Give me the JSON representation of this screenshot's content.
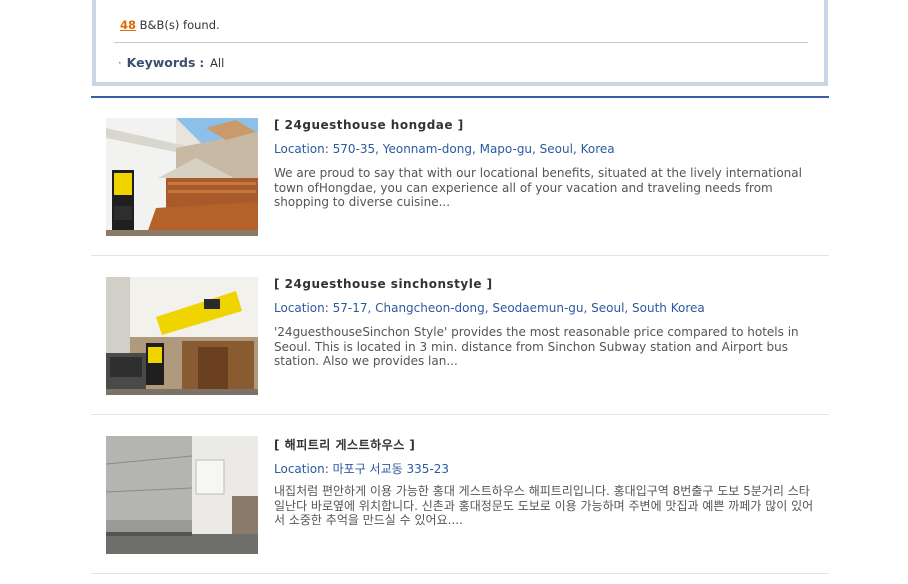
{
  "summary": {
    "count": "48",
    "found_text": "B&B(s) found.",
    "bullet": "·",
    "keywords_label": "Keywords",
    "colon": ":",
    "keywords_value": "All"
  },
  "listings": [
    {
      "title": "[ 24guesthouse hongdae ]",
      "location": "Location: 570-35, Yeonnam-dong, Mapo-gu, Seoul, Korea",
      "description": "We are proud to say that with our locational benefits, situated at the lively international town ofHongdae, you can experience all of your vacation and traveling needs from shopping to diverse cuisine..."
    },
    {
      "title": "[ 24guesthouse sinchonstyle ]",
      "location": "Location: 57-17, Changcheon-dong, Seodaemun-gu, Seoul, South Korea",
      "description": "'24guesthouseSinchon Style' provides the most reasonable price compared to hotels in Seoul. This is located in 3 min. distance from Sinchon Subway station and Airport bus station. Also we provides lan..."
    },
    {
      "title": "[ 해피트리 게스트하우스 ]",
      "location": "Location: 마포구 서교동 335-23",
      "description": "내집처럼 편안하게 이용 가능한 홍대 게스트하우스 해피트리입니다. 홍대입구역 8번출구 도보 5분거리 스타일난다 바로옆에 위치합니다. 신촌과 홍대정문도 도보로 이용 가능하며 주변에 맛집과 예쁜 까페가 많이 있어서 소중한 추억을 만드실 수 있어요...."
    }
  ]
}
